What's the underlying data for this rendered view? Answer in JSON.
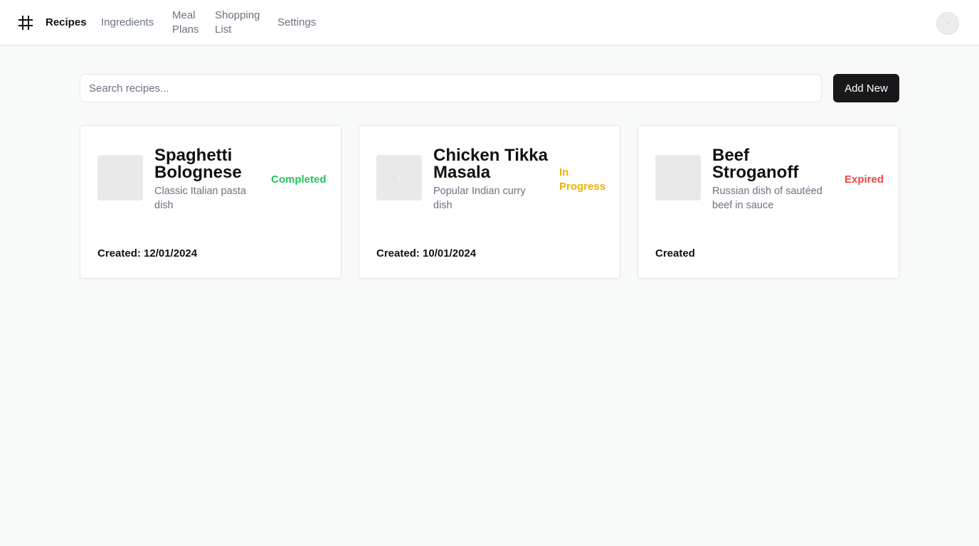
{
  "nav": {
    "items": [
      {
        "lines": [
          "Recipes"
        ],
        "active": true
      },
      {
        "lines": [
          "Ingredients"
        ],
        "active": false
      },
      {
        "lines": [
          "Meal",
          "Plans"
        ],
        "active": false
      },
      {
        "lines": [
          "Shopping",
          "List"
        ],
        "active": false
      },
      {
        "lines": [
          "Settings"
        ],
        "active": false
      }
    ]
  },
  "search": {
    "placeholder": "Search recipes..."
  },
  "actions": {
    "add_new_label": "Add New"
  },
  "colors": {
    "completed": "#22c55e",
    "in_progress": "#eab308",
    "expired": "#ef4444",
    "primary_button": "#18181b"
  },
  "cards": [
    {
      "title_lines": [
        "Spaghetti",
        "Bolognese"
      ],
      "description_lines": [
        "Classic Italian pasta",
        "dish"
      ],
      "status_lines": [
        "Completed"
      ],
      "status_color": "#22c55e",
      "created": "Created: 12/01/2024"
    },
    {
      "title_lines": [
        "Chicken Tikka",
        "Masala"
      ],
      "description_lines": [
        "Popular Indian curry",
        "dish"
      ],
      "status_lines": [
        "In",
        "Progress"
      ],
      "status_color": "#eab308",
      "created": "Created: 10/01/2024"
    },
    {
      "title_lines": [
        "Beef",
        "Stroganoff"
      ],
      "description_lines": [
        "Russian dish of sautéed",
        "beef in sauce"
      ],
      "status_lines": [
        "Expired"
      ],
      "status_color": "#ef4444",
      "created": "Created"
    }
  ]
}
